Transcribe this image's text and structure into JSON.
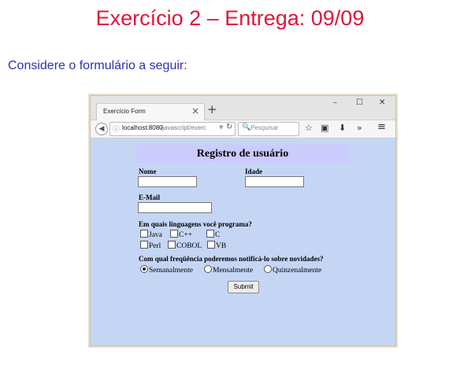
{
  "slide": {
    "title": "Exercício 2 – Entrega: 09/09",
    "intro": "Considere o formulário a seguir:"
  },
  "colors": {
    "title": "#e0153a",
    "intro": "#2f2fb0",
    "page_background": "#c5d6f5",
    "form_header_background": "#cbcbff"
  },
  "browser": {
    "tab_title": "Exercício Form",
    "tab_close": "×",
    "new_tab": "+",
    "window_buttons": {
      "minimize": "–",
      "maximize": "☐",
      "close": "✕"
    },
    "url_host": "localhost:8080",
    "url_path": "/javascript/exerc",
    "url_dropdown": "▼",
    "reload": "↻",
    "search_placeholder": "Pesquisar",
    "icons": [
      "back-arrow-icon",
      "site-info-icon",
      "search-icon",
      "bookmark-star-icon",
      "clipboard-icon",
      "download-icon",
      "overflow-chevron-icon",
      "hamburger-menu-icon"
    ],
    "glyphs": {
      "back": "◀",
      "info": "ⓘ",
      "search": "🔍",
      "star": "☆",
      "clipboard": "▣",
      "download": "⬇",
      "overflow": "»",
      "menu": "≡"
    }
  },
  "form": {
    "header": "Registro de usuário",
    "nome_label": "Nome",
    "idade_label": "Idade",
    "email_label": "E-Mail",
    "nome_value": "",
    "idade_value": "",
    "email_value": "",
    "languages_question": "Em quais linguagens você programa?",
    "languages": [
      {
        "label": "Java",
        "checked": false
      },
      {
        "label": "C++",
        "checked": false
      },
      {
        "label": "C",
        "checked": false
      },
      {
        "label": "Perl",
        "checked": false
      },
      {
        "label": "COBOL",
        "checked": false
      },
      {
        "label": "VB",
        "checked": false
      }
    ],
    "frequency_question": "Com qual freqüência poderemos notificá-lo sobre novidades?",
    "frequencies": [
      {
        "label": "Semanalmente",
        "selected": true
      },
      {
        "label": "Mensalmente",
        "selected": false
      },
      {
        "label": "Quinzenalmente",
        "selected": false
      }
    ],
    "submit_label": "Submit"
  }
}
